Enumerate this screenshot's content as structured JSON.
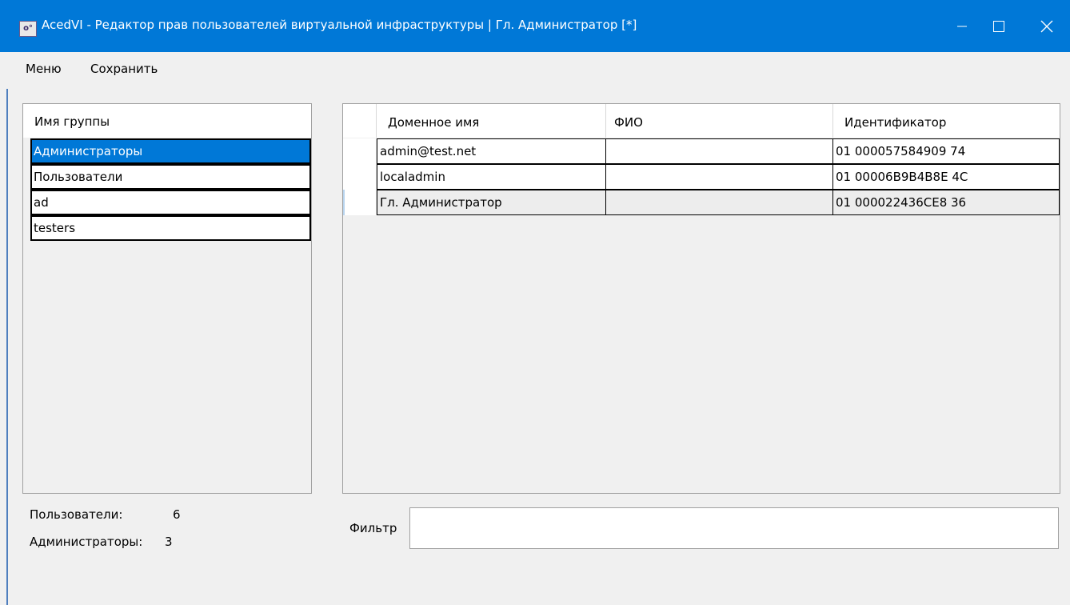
{
  "window": {
    "title": "AcedVI - Редактор прав пользователей виртуальной инфраструктуры | Гл. Администратор [*]",
    "icon": "app-icon",
    "icon_glyph": "o°",
    "controls": {
      "minimize": "minimize-icon",
      "maximize": "maximize-icon",
      "close": "close-icon"
    }
  },
  "menu": {
    "items": [
      {
        "label": "Меню"
      },
      {
        "label": "Сохранить"
      }
    ]
  },
  "groups": {
    "header": "Имя группы",
    "rows": [
      {
        "name": "Администраторы",
        "selected": true
      },
      {
        "name": "Пользователи",
        "selected": false
      },
      {
        "name": "ad",
        "selected": false
      },
      {
        "name": "testers",
        "selected": false
      }
    ]
  },
  "users": {
    "columns": [
      "Доменное имя",
      "ФИО",
      "Идентификатор"
    ],
    "rows": [
      {
        "domain": "admin@test.net",
        "fio": "",
        "id": "01 000057584909 74"
      },
      {
        "domain": "localadmin",
        "fio": "",
        "id": "01 00006B9B4B8E 4C"
      },
      {
        "domain": "Гл. Администратор",
        "fio": "",
        "id": "01 000022436CE8 36"
      }
    ]
  },
  "stats": {
    "users_label": "Пользователи:",
    "users_count": "6",
    "admins_label": "Администраторы:",
    "admins_count": "3"
  },
  "filter": {
    "label": "Фильтр",
    "value": ""
  },
  "colors": {
    "titlebar": "#0078d7",
    "selection": "#0078d7",
    "background": "#f0f0f0"
  }
}
